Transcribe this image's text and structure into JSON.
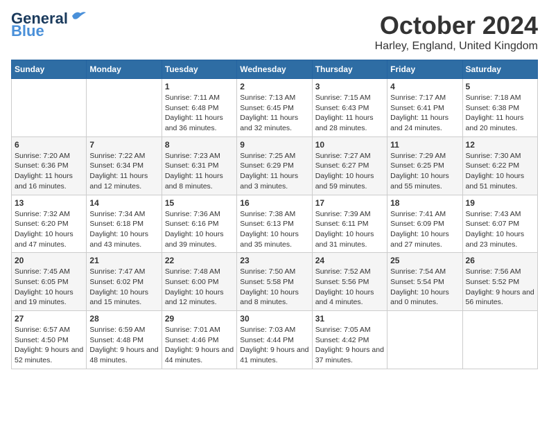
{
  "logo": {
    "line1": "General",
    "line2": "Blue"
  },
  "title": "October 2024",
  "subtitle": "Harley, England, United Kingdom",
  "days_header": [
    "Sunday",
    "Monday",
    "Tuesday",
    "Wednesday",
    "Thursday",
    "Friday",
    "Saturday"
  ],
  "weeks": [
    [
      {
        "num": "",
        "text": ""
      },
      {
        "num": "",
        "text": ""
      },
      {
        "num": "1",
        "text": "Sunrise: 7:11 AM\nSunset: 6:48 PM\nDaylight: 11 hours and 36 minutes."
      },
      {
        "num": "2",
        "text": "Sunrise: 7:13 AM\nSunset: 6:45 PM\nDaylight: 11 hours and 32 minutes."
      },
      {
        "num": "3",
        "text": "Sunrise: 7:15 AM\nSunset: 6:43 PM\nDaylight: 11 hours and 28 minutes."
      },
      {
        "num": "4",
        "text": "Sunrise: 7:17 AM\nSunset: 6:41 PM\nDaylight: 11 hours and 24 minutes."
      },
      {
        "num": "5",
        "text": "Sunrise: 7:18 AM\nSunset: 6:38 PM\nDaylight: 11 hours and 20 minutes."
      }
    ],
    [
      {
        "num": "6",
        "text": "Sunrise: 7:20 AM\nSunset: 6:36 PM\nDaylight: 11 hours and 16 minutes."
      },
      {
        "num": "7",
        "text": "Sunrise: 7:22 AM\nSunset: 6:34 PM\nDaylight: 11 hours and 12 minutes."
      },
      {
        "num": "8",
        "text": "Sunrise: 7:23 AM\nSunset: 6:31 PM\nDaylight: 11 hours and 8 minutes."
      },
      {
        "num": "9",
        "text": "Sunrise: 7:25 AM\nSunset: 6:29 PM\nDaylight: 11 hours and 3 minutes."
      },
      {
        "num": "10",
        "text": "Sunrise: 7:27 AM\nSunset: 6:27 PM\nDaylight: 10 hours and 59 minutes."
      },
      {
        "num": "11",
        "text": "Sunrise: 7:29 AM\nSunset: 6:25 PM\nDaylight: 10 hours and 55 minutes."
      },
      {
        "num": "12",
        "text": "Sunrise: 7:30 AM\nSunset: 6:22 PM\nDaylight: 10 hours and 51 minutes."
      }
    ],
    [
      {
        "num": "13",
        "text": "Sunrise: 7:32 AM\nSunset: 6:20 PM\nDaylight: 10 hours and 47 minutes."
      },
      {
        "num": "14",
        "text": "Sunrise: 7:34 AM\nSunset: 6:18 PM\nDaylight: 10 hours and 43 minutes."
      },
      {
        "num": "15",
        "text": "Sunrise: 7:36 AM\nSunset: 6:16 PM\nDaylight: 10 hours and 39 minutes."
      },
      {
        "num": "16",
        "text": "Sunrise: 7:38 AM\nSunset: 6:13 PM\nDaylight: 10 hours and 35 minutes."
      },
      {
        "num": "17",
        "text": "Sunrise: 7:39 AM\nSunset: 6:11 PM\nDaylight: 10 hours and 31 minutes."
      },
      {
        "num": "18",
        "text": "Sunrise: 7:41 AM\nSunset: 6:09 PM\nDaylight: 10 hours and 27 minutes."
      },
      {
        "num": "19",
        "text": "Sunrise: 7:43 AM\nSunset: 6:07 PM\nDaylight: 10 hours and 23 minutes."
      }
    ],
    [
      {
        "num": "20",
        "text": "Sunrise: 7:45 AM\nSunset: 6:05 PM\nDaylight: 10 hours and 19 minutes."
      },
      {
        "num": "21",
        "text": "Sunrise: 7:47 AM\nSunset: 6:02 PM\nDaylight: 10 hours and 15 minutes."
      },
      {
        "num": "22",
        "text": "Sunrise: 7:48 AM\nSunset: 6:00 PM\nDaylight: 10 hours and 12 minutes."
      },
      {
        "num": "23",
        "text": "Sunrise: 7:50 AM\nSunset: 5:58 PM\nDaylight: 10 hours and 8 minutes."
      },
      {
        "num": "24",
        "text": "Sunrise: 7:52 AM\nSunset: 5:56 PM\nDaylight: 10 hours and 4 minutes."
      },
      {
        "num": "25",
        "text": "Sunrise: 7:54 AM\nSunset: 5:54 PM\nDaylight: 10 hours and 0 minutes."
      },
      {
        "num": "26",
        "text": "Sunrise: 7:56 AM\nSunset: 5:52 PM\nDaylight: 9 hours and 56 minutes."
      }
    ],
    [
      {
        "num": "27",
        "text": "Sunrise: 6:57 AM\nSunset: 4:50 PM\nDaylight: 9 hours and 52 minutes."
      },
      {
        "num": "28",
        "text": "Sunrise: 6:59 AM\nSunset: 4:48 PM\nDaylight: 9 hours and 48 minutes."
      },
      {
        "num": "29",
        "text": "Sunrise: 7:01 AM\nSunset: 4:46 PM\nDaylight: 9 hours and 44 minutes."
      },
      {
        "num": "30",
        "text": "Sunrise: 7:03 AM\nSunset: 4:44 PM\nDaylight: 9 hours and 41 minutes."
      },
      {
        "num": "31",
        "text": "Sunrise: 7:05 AM\nSunset: 4:42 PM\nDaylight: 9 hours and 37 minutes."
      },
      {
        "num": "",
        "text": ""
      },
      {
        "num": "",
        "text": ""
      }
    ]
  ]
}
